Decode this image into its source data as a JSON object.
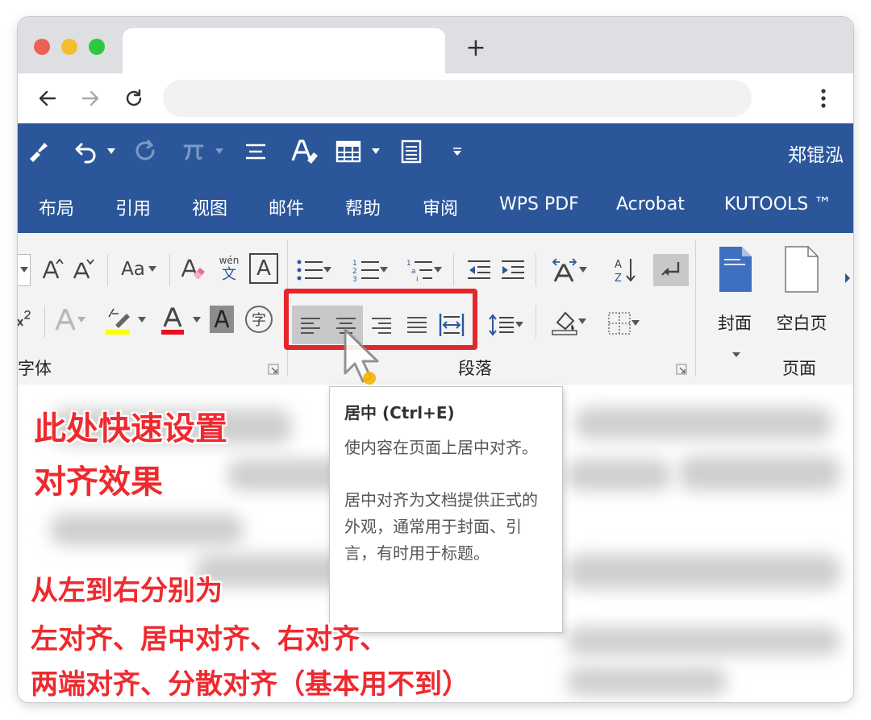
{
  "browser": {
    "new_tab_symbol": "+"
  },
  "ribbon": {
    "user_name": "郑锟泓",
    "tabs": [
      "布局",
      "引用",
      "视图",
      "邮件",
      "帮助",
      "审阅",
      "WPS PDF",
      "Acrobat",
      "KUTOOLS ™"
    ],
    "font_group": {
      "label": "字体",
      "change_case_label": "Aa",
      "phonetic_top": "wén",
      "phonetic_bottom": "文",
      "char_border_label": "A",
      "enclose_char": "字"
    },
    "paragraph_group": {
      "label": "段落"
    },
    "page_group": {
      "label": "页面",
      "cover_label": "封面",
      "blank_page_label": "空白页"
    },
    "highlight_color": "#e5262b",
    "ribbon_color": "#2b579a"
  },
  "tooltip": {
    "title": "居中 (Ctrl+E)",
    "description": "使内容在页面上居中对齐。",
    "detail": "居中对齐为文档提供正式的外观，通常用于封面、引言，有时用于标题。"
  },
  "annotations": {
    "line1": "此处快速设置",
    "line2": "对齐效果",
    "line3": "从左到右分别为",
    "line4": "左对齐、居中对齐、右对齐、",
    "line5": "两端对齐、分散对齐（基本用不到）",
    "color": "#ee2a2f"
  }
}
